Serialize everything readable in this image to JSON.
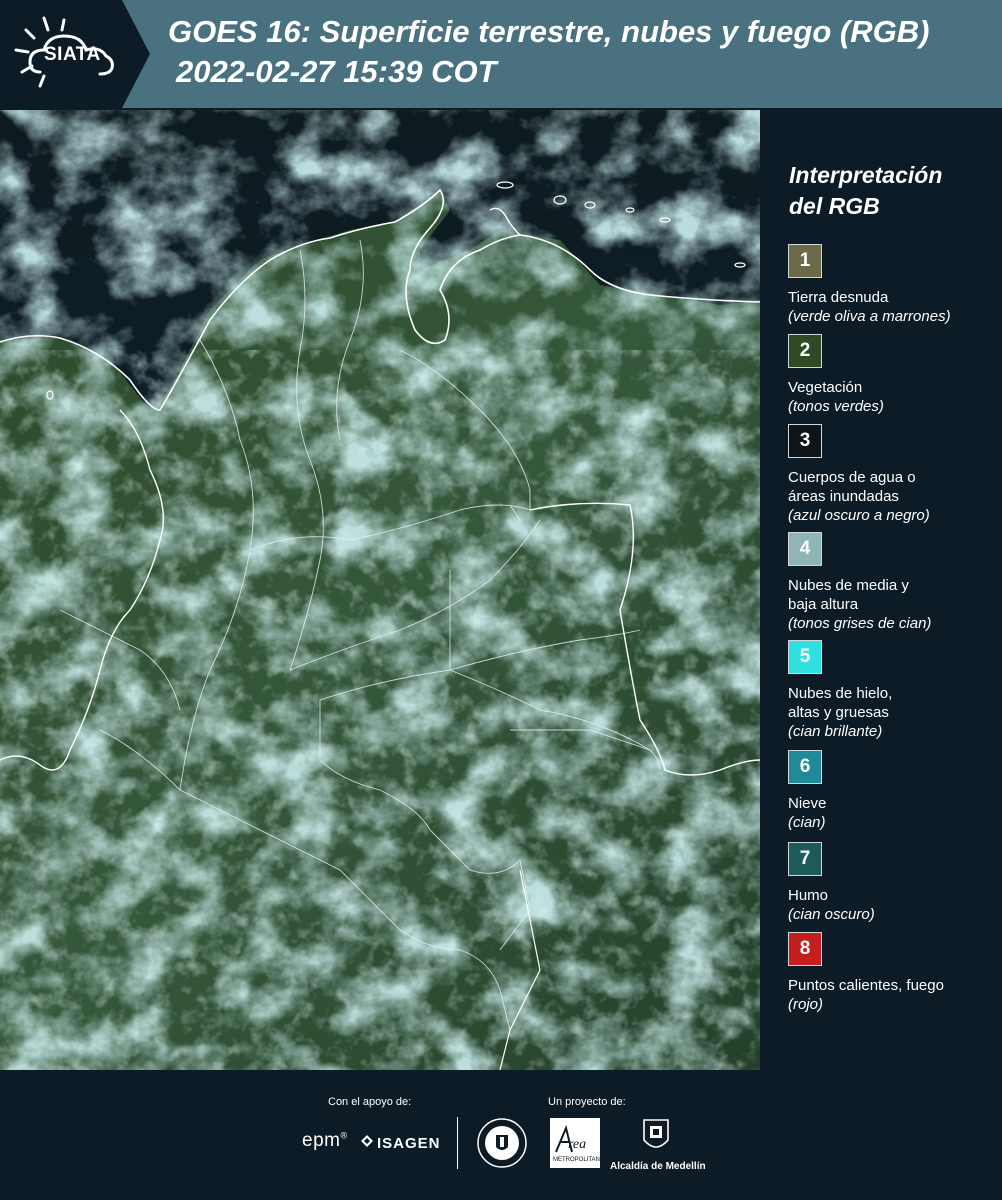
{
  "header": {
    "logo_text": "SIATA",
    "title": "GOES 16: Superficie terrestre, nubes y fuego (RGB)",
    "datetime": "2022-02-27 15:39 COT"
  },
  "legend": {
    "title_line1": "Interpretación",
    "title_line2": "del RGB",
    "items": [
      {
        "number": "1",
        "label": "Tierra desnuda",
        "sub": "(verde oliva a marrones)",
        "color": "#6b6b4a"
      },
      {
        "number": "2",
        "label": "Vegetación",
        "sub": "(tonos verdes)",
        "color": "#2f4a24"
      },
      {
        "number": "3",
        "label": "Cuerpos de agua o áreas inundadas",
        "sub": "(azul oscuro a negro)",
        "color": "#0f1418"
      },
      {
        "number": "4",
        "label": "Nubes de media y baja altura",
        "sub": "(tonos grises de cian)",
        "color": "#8fb5b5"
      },
      {
        "number": "5",
        "label": "Nubes de hielo, altas y gruesas",
        "sub": "(cian brillante)",
        "color": "#2ee0e0"
      },
      {
        "number": "6",
        "label": "Nieve",
        "sub": "(cian)",
        "color": "#1f8a9a"
      },
      {
        "number": "7",
        "label": "Humo",
        "sub": "(cian oscuro)",
        "color": "#1e5a5a"
      },
      {
        "number": "8",
        "label": "Puntos calientes, fuego",
        "sub": "(rojo)",
        "color": "#c41e1e"
      }
    ]
  },
  "footer": {
    "support_label": "Con el apoyo de:",
    "project_label": "Un proyecto de:",
    "epm": "epm",
    "isagen": "ISAGEN",
    "area_text": "Área",
    "area_sub": "METROPOLITANA",
    "alcaldia": "Alcaldía de Medellín"
  }
}
